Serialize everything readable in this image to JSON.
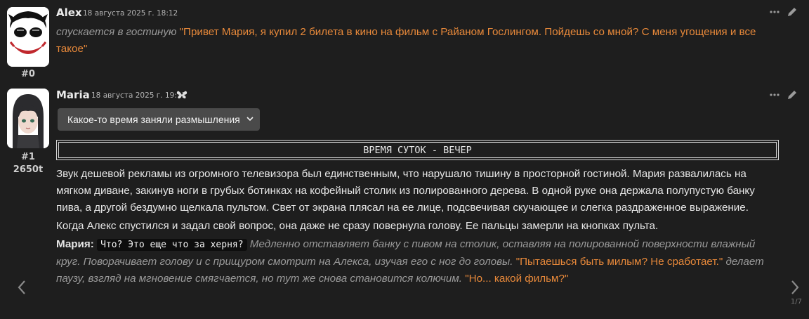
{
  "messages": [
    {
      "name": "Alex",
      "timestamp": "18 августа 2025 г. 18:12",
      "index": "#0",
      "avatar_icon": "joker-avatar",
      "italic_action": "спускается в гостиную",
      "quote": "\"Привет Мария, я купил 2 билета в кино на фильм с Райаном Гослингом. Пойдешь со мной? С меня угощения и все такое\""
    },
    {
      "name": "Maria",
      "timestamp": "18 августа 2025 г. 19:11",
      "index": "#1",
      "tokens": "2650t",
      "avatar_icon": "anime-girl-avatar",
      "badge_icon": "butterfly-icon",
      "dropdown_label": "Какое-то время заняли размышления",
      "time_of_day": "ВРЕМЯ СУТОК - ВЕЧЕР",
      "paragraph1": "Звук дешевой рекламы из огромного телевизора был единственным, что нарушало тишину в просторной гостиной. Мария развалилась на мягком диване, закинув ноги в грубых ботинках на кофейный столик из полированного дерева. В одной руке она держала полупустую банку пива, а другой бездумно щелкала пультом. Свет от экрана плясал на ее лице, подсвечивая скучающее и слегка раздраженное выражение.",
      "paragraph2": "Когда Алекс спустился и задал свой вопрос, она даже не сразу повернула голову. Ее пальцы замерли на кнопках пульта.",
      "speaker": "Мария:",
      "code_speech": "Что? Это еще что за херня?",
      "italic1": "Медленно отставляет банку с пивом на столик, оставляя на полированной поверхности влажный круг. Поворачивает голову и с прищуром смотрит на Алекса, изучая его с ног до головы.",
      "quote1": "\"Пытаешься быть милым? Не сработает.\"",
      "italic2": "делает паузу, взгляд на мгновение смягчается, но тут же снова становится колючим.",
      "quote2": "\"Но... какой фильм?\""
    }
  ],
  "pager": "1/7",
  "colors": {
    "background": "#1e1e1e",
    "quote": "#e8893a",
    "italic": "#9a9a9a"
  }
}
